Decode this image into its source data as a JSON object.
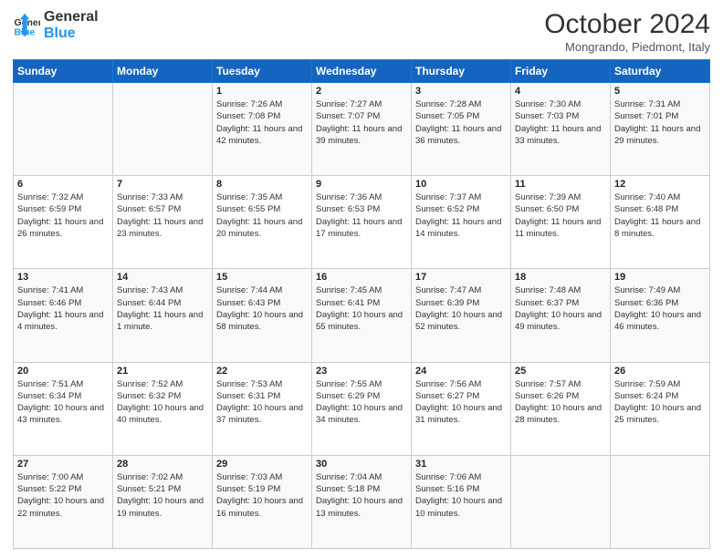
{
  "header": {
    "logo_line1": "General",
    "logo_line2": "Blue",
    "month": "October 2024",
    "location": "Mongrando, Piedmont, Italy"
  },
  "weekdays": [
    "Sunday",
    "Monday",
    "Tuesday",
    "Wednesday",
    "Thursday",
    "Friday",
    "Saturday"
  ],
  "weeks": [
    [
      null,
      null,
      {
        "day": "1",
        "sunrise": "7:26 AM",
        "sunset": "7:08 PM",
        "daylight": "11 hours and 42 minutes."
      },
      {
        "day": "2",
        "sunrise": "7:27 AM",
        "sunset": "7:07 PM",
        "daylight": "11 hours and 39 minutes."
      },
      {
        "day": "3",
        "sunrise": "7:28 AM",
        "sunset": "7:05 PM",
        "daylight": "11 hours and 36 minutes."
      },
      {
        "day": "4",
        "sunrise": "7:30 AM",
        "sunset": "7:03 PM",
        "daylight": "11 hours and 33 minutes."
      },
      {
        "day": "5",
        "sunrise": "7:31 AM",
        "sunset": "7:01 PM",
        "daylight": "11 hours and 29 minutes."
      }
    ],
    [
      {
        "day": "6",
        "sunrise": "7:32 AM",
        "sunset": "6:59 PM",
        "daylight": "11 hours and 26 minutes."
      },
      {
        "day": "7",
        "sunrise": "7:33 AM",
        "sunset": "6:57 PM",
        "daylight": "11 hours and 23 minutes."
      },
      {
        "day": "8",
        "sunrise": "7:35 AM",
        "sunset": "6:55 PM",
        "daylight": "11 hours and 20 minutes."
      },
      {
        "day": "9",
        "sunrise": "7:36 AM",
        "sunset": "6:53 PM",
        "daylight": "11 hours and 17 minutes."
      },
      {
        "day": "10",
        "sunrise": "7:37 AM",
        "sunset": "6:52 PM",
        "daylight": "11 hours and 14 minutes."
      },
      {
        "day": "11",
        "sunrise": "7:39 AM",
        "sunset": "6:50 PM",
        "daylight": "11 hours and 11 minutes."
      },
      {
        "day": "12",
        "sunrise": "7:40 AM",
        "sunset": "6:48 PM",
        "daylight": "11 hours and 8 minutes."
      }
    ],
    [
      {
        "day": "13",
        "sunrise": "7:41 AM",
        "sunset": "6:46 PM",
        "daylight": "11 hours and 4 minutes."
      },
      {
        "day": "14",
        "sunrise": "7:43 AM",
        "sunset": "6:44 PM",
        "daylight": "11 hours and 1 minute."
      },
      {
        "day": "15",
        "sunrise": "7:44 AM",
        "sunset": "6:43 PM",
        "daylight": "10 hours and 58 minutes."
      },
      {
        "day": "16",
        "sunrise": "7:45 AM",
        "sunset": "6:41 PM",
        "daylight": "10 hours and 55 minutes."
      },
      {
        "day": "17",
        "sunrise": "7:47 AM",
        "sunset": "6:39 PM",
        "daylight": "10 hours and 52 minutes."
      },
      {
        "day": "18",
        "sunrise": "7:48 AM",
        "sunset": "6:37 PM",
        "daylight": "10 hours and 49 minutes."
      },
      {
        "day": "19",
        "sunrise": "7:49 AM",
        "sunset": "6:36 PM",
        "daylight": "10 hours and 46 minutes."
      }
    ],
    [
      {
        "day": "20",
        "sunrise": "7:51 AM",
        "sunset": "6:34 PM",
        "daylight": "10 hours and 43 minutes."
      },
      {
        "day": "21",
        "sunrise": "7:52 AM",
        "sunset": "6:32 PM",
        "daylight": "10 hours and 40 minutes."
      },
      {
        "day": "22",
        "sunrise": "7:53 AM",
        "sunset": "6:31 PM",
        "daylight": "10 hours and 37 minutes."
      },
      {
        "day": "23",
        "sunrise": "7:55 AM",
        "sunset": "6:29 PM",
        "daylight": "10 hours and 34 minutes."
      },
      {
        "day": "24",
        "sunrise": "7:56 AM",
        "sunset": "6:27 PM",
        "daylight": "10 hours and 31 minutes."
      },
      {
        "day": "25",
        "sunrise": "7:57 AM",
        "sunset": "6:26 PM",
        "daylight": "10 hours and 28 minutes."
      },
      {
        "day": "26",
        "sunrise": "7:59 AM",
        "sunset": "6:24 PM",
        "daylight": "10 hours and 25 minutes."
      }
    ],
    [
      {
        "day": "27",
        "sunrise": "7:00 AM",
        "sunset": "5:22 PM",
        "daylight": "10 hours and 22 minutes."
      },
      {
        "day": "28",
        "sunrise": "7:02 AM",
        "sunset": "5:21 PM",
        "daylight": "10 hours and 19 minutes."
      },
      {
        "day": "29",
        "sunrise": "7:03 AM",
        "sunset": "5:19 PM",
        "daylight": "10 hours and 16 minutes."
      },
      {
        "day": "30",
        "sunrise": "7:04 AM",
        "sunset": "5:18 PM",
        "daylight": "10 hours and 13 minutes."
      },
      {
        "day": "31",
        "sunrise": "7:06 AM",
        "sunset": "5:16 PM",
        "daylight": "10 hours and 10 minutes."
      },
      null,
      null
    ]
  ]
}
